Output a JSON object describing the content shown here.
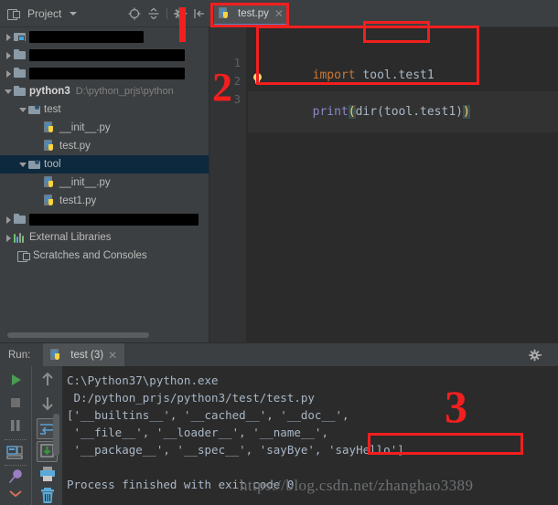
{
  "window": {
    "theme_bg": "#3c3f41",
    "editor_bg": "#2b2b2b",
    "accent": "#4a88c7",
    "annotation_color": "#f21f1f"
  },
  "project_panel": {
    "title": "Project",
    "title_icon": "project-icon",
    "dropdown_icon": "chevron-down-icon",
    "toolbar_icons": [
      {
        "name": "locate-icon"
      },
      {
        "name": "collapse-all-icon"
      },
      {
        "name": "settings-gear-icon"
      },
      {
        "name": "hide-panel-icon"
      }
    ],
    "tree": [
      {
        "id": "row-redacted-1",
        "indent": 0,
        "arrow": "closed",
        "icon": "module-folder-icon",
        "label": "",
        "redacted": true,
        "redact_width": 125,
        "selected": false
      },
      {
        "id": "row-redacted-2",
        "indent": 0,
        "arrow": "closed",
        "icon": "folder-icon",
        "label": "",
        "redacted": true,
        "redact_width": 170,
        "selected": false
      },
      {
        "id": "row-redacted-3",
        "indent": 0,
        "arrow": "closed",
        "icon": "folder-icon",
        "label": "",
        "redacted": true,
        "redact_width": 170,
        "selected": false
      },
      {
        "id": "row-python3",
        "indent": 0,
        "arrow": "open",
        "icon": "folder-icon",
        "label": "python3",
        "bold": true,
        "path": "D:\\python_prjs\\python",
        "selected": false
      },
      {
        "id": "row-test-pkg",
        "indent": 1,
        "arrow": "open",
        "icon": "source-folder-icon",
        "label": "test",
        "selected": false
      },
      {
        "id": "row-test-init",
        "indent": 2,
        "arrow": "none",
        "icon": "python-file-icon",
        "label": "__init__.py",
        "selected": false
      },
      {
        "id": "row-test-py",
        "indent": 2,
        "arrow": "none",
        "icon": "python-file-icon",
        "label": "test.py",
        "selected": false
      },
      {
        "id": "row-tool-pkg",
        "indent": 1,
        "arrow": "open",
        "icon": "source-folder-icon",
        "label": "tool",
        "selected": true
      },
      {
        "id": "row-tool-init",
        "indent": 2,
        "arrow": "none",
        "icon": "python-file-icon",
        "label": "__init__.py",
        "selected": false
      },
      {
        "id": "row-test1-py",
        "indent": 2,
        "arrow": "none",
        "icon": "python-file-icon",
        "label": "test1.py",
        "selected": false
      },
      {
        "id": "row-redacted-4",
        "indent": 0,
        "arrow": "closed",
        "icon": "folder-icon",
        "label": "",
        "redacted": true,
        "redact_width": 185,
        "selected": false
      },
      {
        "id": "row-external-libraries",
        "indent": 0,
        "arrow": "closed",
        "icon": "libraries-icon",
        "label": "External Libraries",
        "selected": false
      },
      {
        "id": "row-scratches",
        "indent": 0,
        "arrow": "none",
        "icon": "scratches-icon",
        "label": "Scratches and Consoles",
        "selected": false
      }
    ]
  },
  "editor": {
    "tab": {
      "label": "test.py",
      "icon": "python-file-icon",
      "close_icon": "close-icon",
      "active": true
    },
    "line_numbers": [
      "1",
      "2",
      "3"
    ],
    "lines": [
      {
        "n": 1,
        "tokens": [
          {
            "t": "import",
            "c": "kw"
          },
          {
            "t": " ",
            "c": "ident"
          },
          {
            "t": "tool.test1",
            "c": "ident"
          }
        ]
      },
      {
        "n": 2,
        "tokens": []
      },
      {
        "n": 3,
        "tokens": [
          {
            "t": "print",
            "c": "fn"
          },
          {
            "t": "(",
            "c": "brace"
          },
          {
            "t": "dir(tool.test1)",
            "c": "ident"
          },
          {
            "t": ")",
            "c": "brace"
          }
        ]
      }
    ],
    "line1_text": "import tool.test1",
    "line3_text": "print(dir(tool.test1))",
    "inspection_icon": "lightbulb-icon"
  },
  "run_panel": {
    "label": "Run:",
    "tab_label": "test (3)",
    "tab_icon": "python-file-icon",
    "tab_close_icon": "close-icon",
    "gear_icon": "settings-gear-icon",
    "left_buttons": [
      {
        "name": "rerun-button",
        "icon": "play-icon"
      },
      {
        "name": "stop-button",
        "icon": "stop-icon"
      },
      {
        "name": "pause-output-button",
        "icon": "pause-icon"
      },
      {
        "name": "restore-layout-button",
        "icon": "layout-icon"
      },
      {
        "name": "pin-tab-button",
        "icon": "pin-icon"
      },
      {
        "name": "expand-button",
        "icon": "expand-icon"
      }
    ],
    "second_buttons": [
      {
        "name": "scroll-up-button",
        "icon": "arrow-up-icon"
      },
      {
        "name": "scroll-down-button",
        "icon": "arrow-down-icon"
      },
      {
        "name": "soft-wrap-button",
        "icon": "wrap-icon"
      },
      {
        "name": "scroll-to-end-button",
        "icon": "scroll-end-icon"
      },
      {
        "name": "print-button",
        "icon": "printer-icon"
      },
      {
        "name": "clear-all-button",
        "icon": "trash-icon"
      }
    ],
    "console_lines": [
      "C:\\Python37\\python.exe",
      " D:/python_prjs/python3/test/test.py",
      "['__builtins__', '__cached__', '__doc__',",
      " '__file__', '__loader__', '__name__',",
      " '__package__', '__spec__', 'sayBye', 'sayHello']",
      "",
      "Process finished with exit code 0"
    ]
  },
  "watermark": {
    "text": "https://blog.csdn.net/zhanghao3389"
  },
  "annotations": [
    {
      "id": "marker-1",
      "label": "1",
      "type": "bar"
    },
    {
      "id": "marker-2",
      "label": "2",
      "type": "number"
    },
    {
      "id": "marker-3",
      "label": "3",
      "type": "number"
    },
    {
      "id": "box-tab",
      "type": "box",
      "target": "editor-tab"
    },
    {
      "id": "box-code",
      "type": "box",
      "target": "code-block"
    },
    {
      "id": "box-test1",
      "type": "box",
      "target": "import-module-name"
    },
    {
      "id": "box-output",
      "type": "box",
      "target": "console-members"
    }
  ]
}
